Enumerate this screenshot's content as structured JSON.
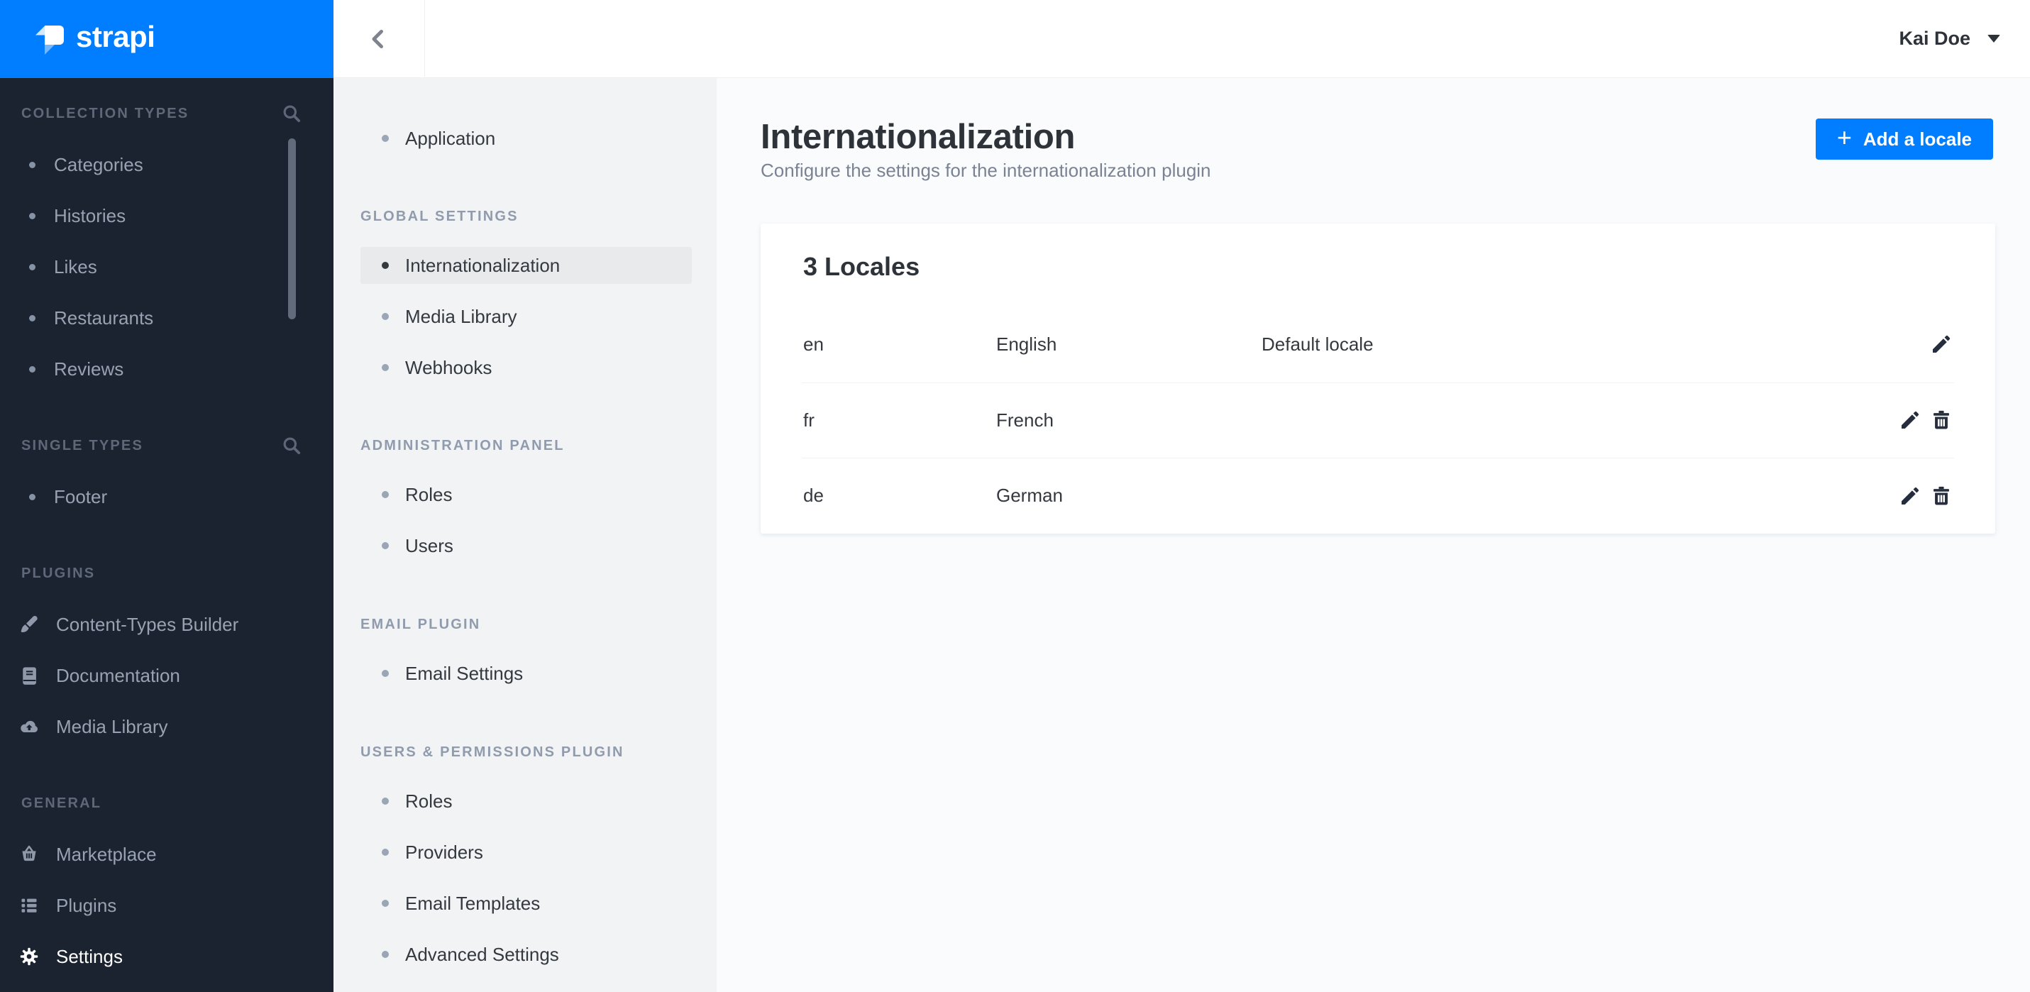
{
  "app": {
    "logo_text": "strapi"
  },
  "colors": {
    "accent": "#007eff",
    "sidebar_bg": "#1c2330",
    "subsidebar_bg": "#f2f3f4",
    "selected_item_bg": "#e9eaeb",
    "card_bg": "#ffffff"
  },
  "header": {
    "user_name": "Kai Doe"
  },
  "sidebar": {
    "sections": [
      {
        "label": "COLLECTION TYPES",
        "items": [
          {
            "label": "Categories"
          },
          {
            "label": "Histories"
          },
          {
            "label": "Likes"
          },
          {
            "label": "Restaurants"
          },
          {
            "label": "Reviews"
          }
        ]
      },
      {
        "label": "SINGLE TYPES",
        "items": [
          {
            "label": "Footer"
          }
        ]
      },
      {
        "label": "PLUGINS",
        "items": [
          {
            "label": "Content-Types Builder"
          },
          {
            "label": "Documentation"
          },
          {
            "label": "Media Library"
          }
        ]
      },
      {
        "label": "GENERAL",
        "items": [
          {
            "label": "Marketplace"
          },
          {
            "label": "Plugins"
          },
          {
            "label": "Settings"
          }
        ]
      }
    ]
  },
  "settings_nav": {
    "standalone": [
      {
        "label": "Application"
      }
    ],
    "groups": [
      {
        "label": "GLOBAL SETTINGS",
        "items": [
          {
            "label": "Internationalization"
          },
          {
            "label": "Media Library"
          },
          {
            "label": "Webhooks"
          }
        ]
      },
      {
        "label": "ADMINISTRATION PANEL",
        "items": [
          {
            "label": "Roles"
          },
          {
            "label": "Users"
          }
        ]
      },
      {
        "label": "EMAIL PLUGIN",
        "items": [
          {
            "label": "Email Settings"
          }
        ]
      },
      {
        "label": "USERS & PERMISSIONS PLUGIN",
        "items": [
          {
            "label": "Roles"
          },
          {
            "label": "Providers"
          },
          {
            "label": "Email Templates"
          },
          {
            "label": "Advanced Settings"
          }
        ]
      }
    ]
  },
  "page": {
    "title": "Internationalization",
    "subtitle": "Configure the settings for the internationalization plugin",
    "add_locale_button": "Add a locale",
    "plus_sign": "+"
  },
  "locales_table": {
    "heading": "3 Locales",
    "rows": [
      {
        "code": "en",
        "name": "English",
        "note": "Default locale"
      },
      {
        "code": "fr",
        "name": "French",
        "note": ""
      },
      {
        "code": "de",
        "name": "German",
        "note": ""
      }
    ]
  }
}
